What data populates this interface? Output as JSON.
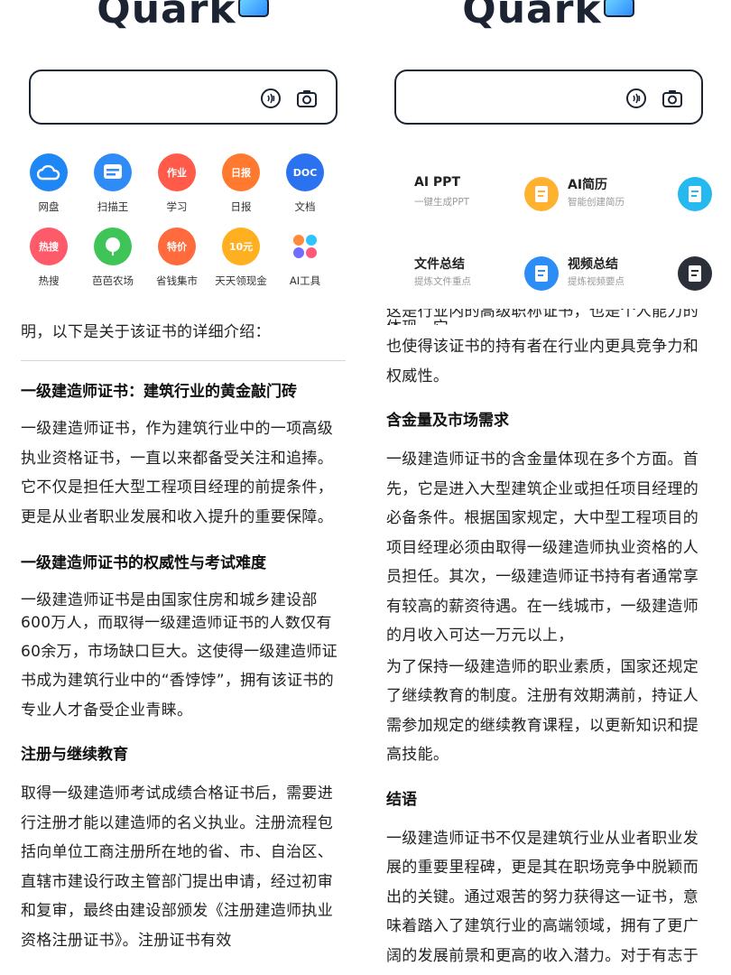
{
  "logo": "Quark",
  "left": {
    "apps_row1": [
      {
        "label": "网盘",
        "icon": "cloud-drive-icon",
        "color": "#1f86f5"
      },
      {
        "label": "扫描王",
        "icon": "scan-icon",
        "color": "#2f8cf7"
      },
      {
        "label": "学习",
        "icon": "study-icon",
        "color": "#ff5a4a",
        "text": "作业"
      },
      {
        "label": "日报",
        "icon": "daily-icon",
        "color": "#ff7a2e",
        "text": "日报"
      },
      {
        "label": "文档",
        "icon": "doc-icon",
        "color": "#2a72f0",
        "text": "DOC"
      }
    ],
    "apps_row2": [
      {
        "label": "热搜",
        "icon": "hot-search-icon",
        "color": "#ff5a6a",
        "text": "热搜"
      },
      {
        "label": "芭芭农场",
        "icon": "farm-icon",
        "color": "#3fc457"
      },
      {
        "label": "省钱集市",
        "icon": "market-icon",
        "color": "#ff6b3d",
        "text": "特价"
      },
      {
        "label": "天天领现金",
        "icon": "cash-icon",
        "color": "#ffb020",
        "text": "10元"
      },
      {
        "label": "AI工具",
        "icon": "ai-tools-icon",
        "color": "#ffffff"
      }
    ],
    "intro_tail": "明，以下是关于该证书的详细介绍：",
    "h1": "一级建造师证书：建筑行业的黄金敲门砖",
    "p1": "一级建造师证书，作为建筑行业中的一项高级执业资格证书，一直以来都备受关注和追捧。它不仅是担任大型工程项目经理的前提条件，更是从业者职业发展和收入提升的重要保障。",
    "h2": "一级建造师证书的权威性与考试难度",
    "p2a": "一级建造师证书是由国家住房和城乡建设部",
    "p2b": "600万人，而取得一级建造师证书的人数仅有",
    "p2c": "60余万，市场缺口巨大。这使得一级建造师证书成为建筑行业中的“香饽饽”，拥有该证书的专业人才备受企业青睐。",
    "h3": "注册与继续教育",
    "p3": "取得一级建造师考试成绩合格证书后，需要进行注册才能以建造师的名义执业。注册流程包括向单位工商注册所在地的省、市、自治区、直辖市建设行政主管部门提出申请，经过初审和复审，最终由建设部颁发《注册建造师执业资格注册证书》。注册证书有效"
  },
  "right": {
    "tools": [
      {
        "title": "AI PPT",
        "subtitle": "一键生成PPT",
        "icon": "ai-ppt-icon",
        "color": "#ffb230"
      },
      {
        "title": "AI简历",
        "subtitle": "智能创建简历",
        "icon": "ai-resume-icon",
        "color": "#26b9f0"
      },
      {
        "title": "文件总结",
        "subtitle": "提炼文件重点",
        "icon": "file-summary-icon",
        "color": "#2b8df5"
      },
      {
        "title": "视频总结",
        "subtitle": "提炼视频要点",
        "icon": "video-summary-icon",
        "color": "#2b2f38"
      }
    ],
    "top_cut": "这是行业内的高级职称证书，也是个人能力的体现，它",
    "p0": "也使得该证书的持有者在行业内更具竞争力和权威性。",
    "h1": "含金量及市场需求",
    "p1a": "一级建造师证书的含金量体现在多个方面。首先，它是进入大型建筑企业或担任项目经理的必备条件。根据国家规定，大中型工程项目的项目经理必须由取得一级建造师执业资格的人员担任。其次，一级建造师证书持有者通常享有较高的薪资待遇。在一线城市，一级建造师的月收入可达一万元以上，",
    "p1b": "为了保持一级建造师的职业素质，国家还规定了继续教育的制度。注册有效期满前，持证人需参加规定的继续教育课程，以更新知识和提高技能。",
    "h2": "结语",
    "p2": "一级建造师证书不仅是建筑行业从业者职业发展的重要里程碑，更是其在职场竞争中脱颖而出的关键。通过艰苦的努力获得这一证书，意味着踏入了建筑行业的高端领域，拥有了更广阔的发展前景和更高的收入潜力。对于有志于在建筑行业长远发展的专业人士"
  }
}
